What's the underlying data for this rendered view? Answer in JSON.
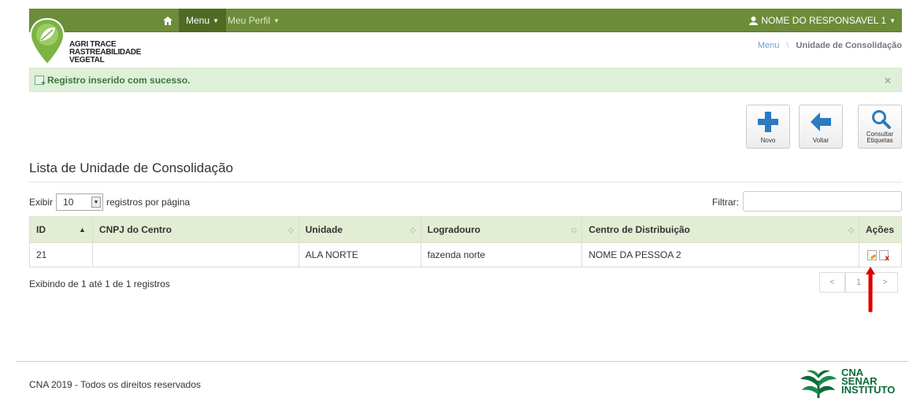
{
  "navbar": {
    "menu_label": "Menu",
    "perfil_label": "Meu Perfil",
    "user_label": "NOME DO RESPONSAVEL 1"
  },
  "logo": {
    "line1": "AGRI TRACE",
    "line2": "RASTREABILIDADE",
    "line3": "VEGETAL"
  },
  "breadcrumb": {
    "menu": "Menu",
    "current": "Unidade de Consolidação"
  },
  "alert": {
    "message": "Registro inserido com sucesso.",
    "close": "×"
  },
  "toolbar": {
    "novo": "Novo",
    "voltar": "Voltar",
    "consultar_line1": "Consultar",
    "consultar_line2": "Etiquetas"
  },
  "page_title": "Lista de Unidade de Consolidação",
  "length": {
    "prefix": "Exibir",
    "value": "10",
    "suffix": "registros por página"
  },
  "filter": {
    "label": "Filtrar:"
  },
  "table": {
    "columns": [
      "ID",
      "CNPJ do Centro",
      "Unidade",
      "Logradouro",
      "Centro de Distribuição",
      "Ações"
    ],
    "rows": [
      {
        "id": "21",
        "cnpj": "",
        "unidade": "ALA NORTE",
        "logradouro": "fazenda norte",
        "centro": "NOME DA PESSOA 2"
      }
    ]
  },
  "info": "Exibindo de 1 até 1 de 1 registros",
  "pagination": {
    "prev": "<",
    "current": "1",
    "next": ">"
  },
  "footer": {
    "copyright": "CNA 2019 - Todos os direitos reservados"
  },
  "cna_logo": {
    "line1": "CNA",
    "line2": "SENAR",
    "line3": "INSTITUTO"
  },
  "colors": {
    "navbar": "#6c8c3a",
    "alert_bg": "#dff0d8",
    "table_header": "#e3edd4",
    "arrow": "#e00000"
  }
}
